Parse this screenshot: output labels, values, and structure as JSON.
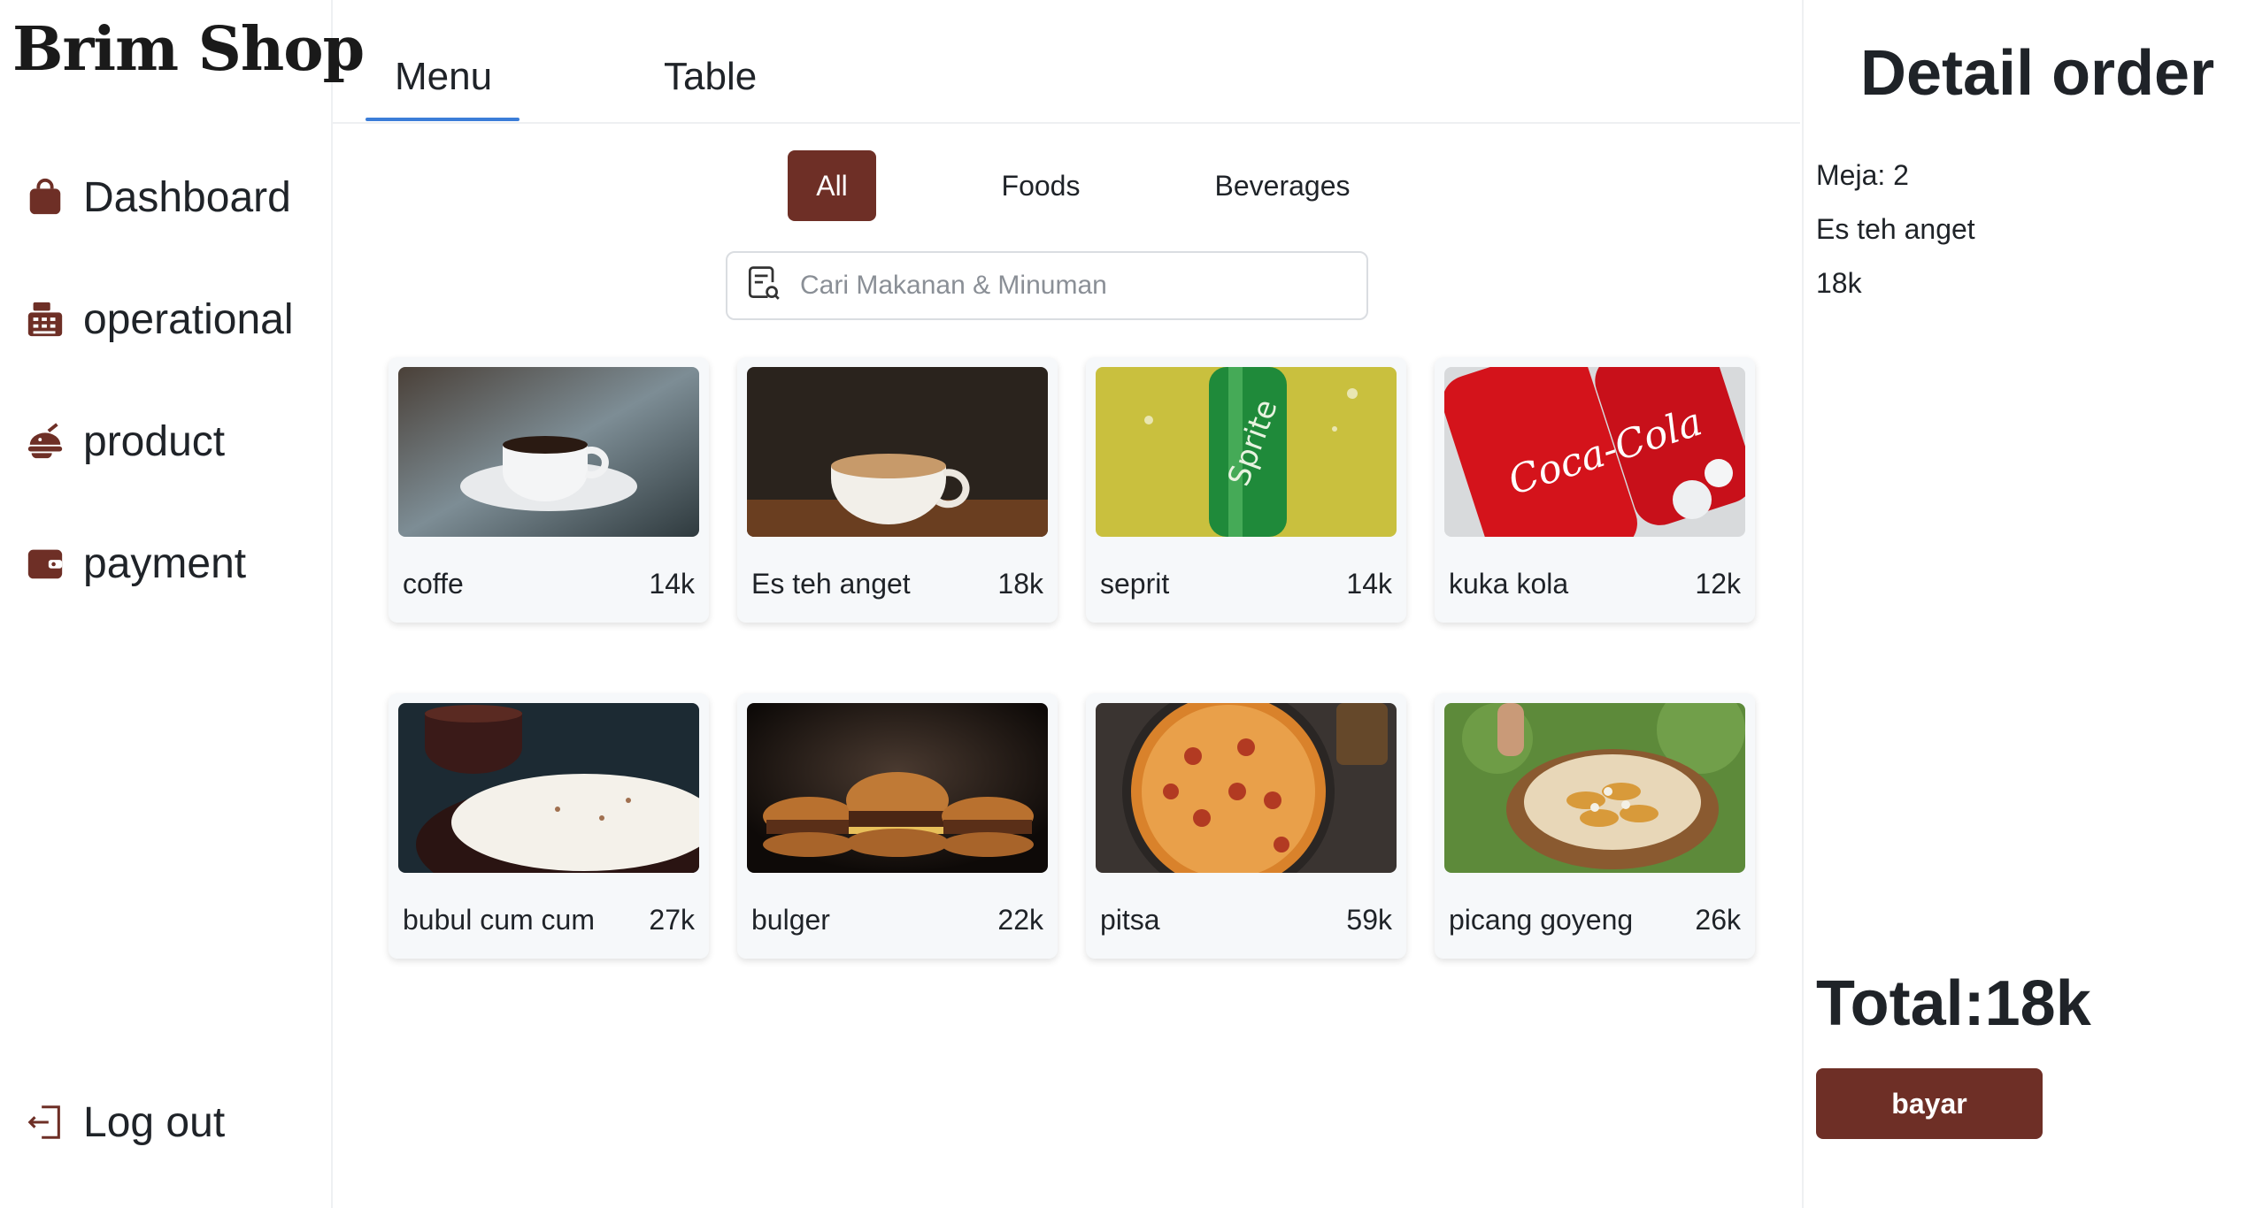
{
  "app": {
    "brand": "Brim Shop",
    "accent_color": "#6e2f26",
    "tab_underline_color": "#3b7dd8"
  },
  "sidebar": {
    "items": [
      {
        "label": "Dashboard",
        "icon": "shopping-bag-icon"
      },
      {
        "label": "operational",
        "icon": "cash-register-icon"
      },
      {
        "label": "product",
        "icon": "food-icon"
      },
      {
        "label": "payment",
        "icon": "wallet-icon"
      }
    ],
    "logout": {
      "label": "Log out",
      "icon": "logout-icon"
    }
  },
  "tabs": [
    {
      "label": "Menu",
      "active": true
    },
    {
      "label": "Table",
      "active": false
    }
  ],
  "filters": [
    {
      "label": "All",
      "active": true
    },
    {
      "label": "Foods",
      "active": false
    },
    {
      "label": "Beverages",
      "active": false
    }
  ],
  "search": {
    "placeholder": "Cari Makanan & Minuman",
    "value": "",
    "icon": "receipt-search-icon"
  },
  "products": [
    {
      "name": "coffe",
      "price": "14k",
      "image": "coffee-cup-photo"
    },
    {
      "name": "Es teh anget",
      "price": "18k",
      "image": "latte-cup-photo"
    },
    {
      "name": "seprit",
      "price": "14k",
      "image": "sprite-bottle-photo"
    },
    {
      "name": "kuka kola",
      "price": "12k",
      "image": "coca-cola-cans-photo"
    },
    {
      "name": "bubul cum cum",
      "price": "27k",
      "image": "rice-bowl-photo"
    },
    {
      "name": "bulger",
      "price": "22k",
      "image": "burgers-photo"
    },
    {
      "name": "pitsa",
      "price": "59k",
      "image": "pizza-photo"
    },
    {
      "name": "picang goyeng",
      "price": "26k",
      "image": "fried-banana-photo"
    }
  ],
  "detail": {
    "title": "Detail order",
    "table": "Meja: 2",
    "items": [
      {
        "name": "Es teh anget",
        "price": "18k"
      }
    ],
    "total": "Total:18k",
    "pay_label": "bayar"
  }
}
